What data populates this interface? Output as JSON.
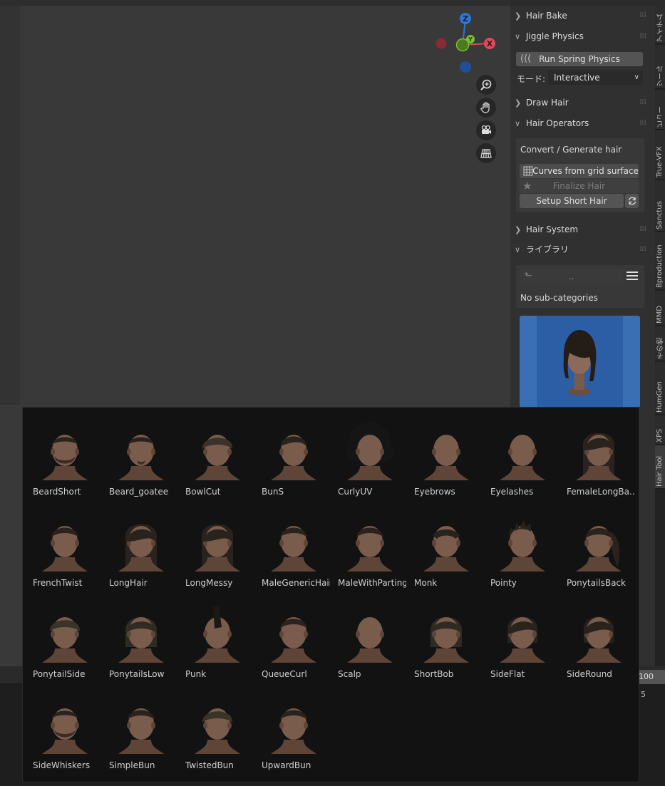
{
  "gizmo": {
    "z_label": "Z",
    "x_label": "X",
    "y_label": "Y"
  },
  "navigation": [
    "zoom-icon",
    "hand-icon",
    "camera-icon",
    "grid-icon"
  ],
  "panel": {
    "hair_bake": "Hair Bake",
    "jiggle_physics": "Jiggle Physics",
    "run_spring_physics": "Run Spring Physics",
    "mode_label": "モード:",
    "mode_value": "Interactive",
    "draw_hair": "Draw Hair",
    "hair_operators": "Hair Operators",
    "convert_generate": "Convert / Generate hair",
    "curves_from_grid": "Curves from grid surface",
    "finalize_hair": "Finalize Hair",
    "setup_short_hair": "Setup Short Hair",
    "hair_system": "Hair System",
    "library": "ライブラリ",
    "breadcrumb": "..",
    "no_sub_categories": "No sub-categories"
  },
  "tabs": [
    "アイテム",
    "ツール",
    "ビュー",
    "True-VFX",
    "Sanctus",
    "Bproduction",
    "MMD",
    "その他",
    "HumGen",
    "XPS",
    "Hair Tool"
  ],
  "timeline": {
    "end_frame": "100",
    "current": "5"
  },
  "library_items": [
    {
      "name": "BeardShort",
      "hair": "beard"
    },
    {
      "name": "Beard_goatee",
      "hair": "goatee"
    },
    {
      "name": "BowlCut",
      "hair": "bowl"
    },
    {
      "name": "BunS",
      "hair": "bun"
    },
    {
      "name": "CurlyUV",
      "hair": "curly"
    },
    {
      "name": "Eyebrows",
      "hair": "bald"
    },
    {
      "name": "Eyelashes",
      "hair": "bald"
    },
    {
      "name": "FemaleLongBa...",
      "hair": "long"
    },
    {
      "name": "FrenchTwist",
      "hair": "short"
    },
    {
      "name": "LongHair",
      "hair": "long"
    },
    {
      "name": "LongMessy",
      "hair": "long"
    },
    {
      "name": "MaleGenericHair",
      "hair": "short"
    },
    {
      "name": "MaleWithParting",
      "hair": "short"
    },
    {
      "name": "Monk",
      "hair": "monk"
    },
    {
      "name": "Pointy",
      "hair": "spiky"
    },
    {
      "name": "PonytailsBack",
      "hair": "ponytail"
    },
    {
      "name": "PonytailSide",
      "hair": "bowl"
    },
    {
      "name": "PonytailsLow",
      "hair": "bob"
    },
    {
      "name": "Punk",
      "hair": "mohawk"
    },
    {
      "name": "QueueCurl",
      "hair": "short"
    },
    {
      "name": "Scalp",
      "hair": "bald"
    },
    {
      "name": "ShortBob",
      "hair": "bob"
    },
    {
      "name": "SideFlat",
      "hair": "side"
    },
    {
      "name": "SideRound",
      "hair": "side"
    },
    {
      "name": "SideWhiskers",
      "hair": "beard"
    },
    {
      "name": "SimpleBun",
      "hair": "short"
    },
    {
      "name": "TwistedBun",
      "hair": "bowl"
    },
    {
      "name": "UpwardBun",
      "hair": "short"
    }
  ],
  "colors": {
    "accent": "#3b6fb4",
    "x_axis": "#e04a58",
    "y_axis": "#7cbf2f",
    "z_axis": "#2f77d6"
  }
}
